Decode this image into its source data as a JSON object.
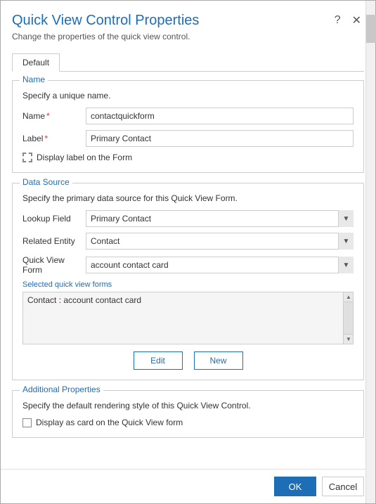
{
  "dialog": {
    "title": "Quick View Control Properties",
    "subtitle": "Change the properties of the quick view control.",
    "help_icon": "?",
    "close_icon": "✕"
  },
  "tabs": [
    {
      "label": "Default",
      "active": true
    }
  ],
  "name_section": {
    "legend": "Name",
    "description": "Specify a unique name.",
    "name_label": "Name",
    "name_required": "*",
    "name_value": "contactquickform",
    "label_label": "Label",
    "label_required": "*",
    "label_value": "Primary Contact",
    "checkbox_label": "Display label on the Form"
  },
  "data_source_section": {
    "legend": "Data Source",
    "description": "Specify the primary data source for this Quick View Form.",
    "lookup_field_label": "Lookup Field",
    "lookup_field_value": "Primary Contact",
    "related_entity_label": "Related Entity",
    "related_entity_value": "Contact",
    "quick_view_form_label": "Quick View Form",
    "quick_view_form_value": "account contact card",
    "selected_label": "Selected quick view forms",
    "list_item": "Contact : account contact card",
    "edit_button": "Edit",
    "new_button": "New"
  },
  "additional_section": {
    "legend": "Additional Properties",
    "description": "Specify the default rendering style of this Quick View Control.",
    "checkbox_label": "Display as card on the Quick View form"
  },
  "footer": {
    "ok_label": "OK",
    "cancel_label": "Cancel"
  }
}
